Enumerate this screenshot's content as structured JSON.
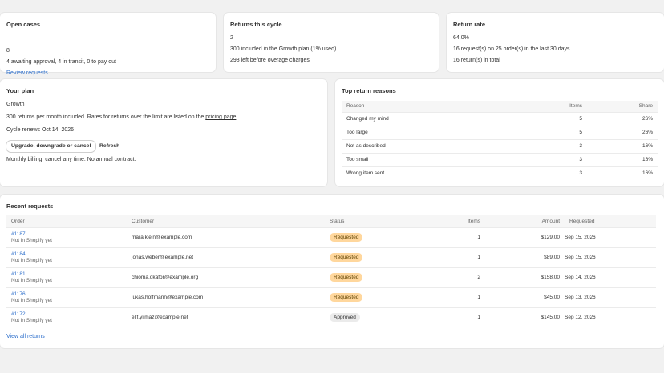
{
  "open_cases": {
    "title": "Open cases",
    "value": "8",
    "detail": "4 awaiting approval, 4 in transit, 0 to pay out",
    "link": "Review requests"
  },
  "returns_cycle": {
    "title": "Returns this cycle",
    "value": "2",
    "included": "300 included in the Growth plan (1% used)",
    "left": "298 left before overage charges"
  },
  "return_rate": {
    "title": "Return rate",
    "value": "64.0%",
    "detail": "16 request(s) on 25 order(s) in the last 30 days",
    "total": "16 return(s) in total"
  },
  "plan": {
    "title": "Your plan",
    "name": "Growth",
    "desc_prefix": "300 returns per month included. Rates for returns over the limit are listed on the ",
    "desc_link": "pricing page",
    "desc_suffix": ".",
    "renews": "Cycle renews Oct 14, 2026",
    "upgrade_label": "Upgrade, downgrade or cancel",
    "refresh_label": "Refresh",
    "billing_note": "Monthly billing, cancel any time. No annual contract."
  },
  "reasons": {
    "title": "Top return reasons",
    "headers": {
      "reason": "Reason",
      "items": "Items",
      "share": "Share"
    },
    "rows": [
      {
        "reason": "Changed my mind",
        "items": "5",
        "share": "26%"
      },
      {
        "reason": "Too large",
        "items": "5",
        "share": "26%"
      },
      {
        "reason": "Not as described",
        "items": "3",
        "share": "16%"
      },
      {
        "reason": "Too small",
        "items": "3",
        "share": "16%"
      },
      {
        "reason": "Wrong item sent",
        "items": "3",
        "share": "16%"
      }
    ]
  },
  "recent": {
    "title": "Recent requests",
    "headers": {
      "order": "Order",
      "customer": "Customer",
      "status": "Status",
      "items": "Items",
      "amount": "Amount",
      "requested": "Requested"
    },
    "rows": [
      {
        "order": "#1187",
        "sub": "Not in Shopify yet",
        "customer": "mara.klein@example.com",
        "status": "Requested",
        "items": "1",
        "amount": "$129.00",
        "requested": "Sep 15, 2026"
      },
      {
        "order": "#1184",
        "sub": "Not in Shopify yet",
        "customer": "jonas.weber@example.net",
        "status": "Requested",
        "items": "1",
        "amount": "$89.00",
        "requested": "Sep 15, 2026"
      },
      {
        "order": "#1181",
        "sub": "Not in Shopify yet",
        "customer": "chioma.okafor@example.org",
        "status": "Requested",
        "items": "2",
        "amount": "$158.00",
        "requested": "Sep 14, 2026"
      },
      {
        "order": "#1176",
        "sub": "Not in Shopify yet",
        "customer": "lukas.hoffmann@example.com",
        "status": "Requested",
        "items": "1",
        "amount": "$45.00",
        "requested": "Sep 13, 2026"
      },
      {
        "order": "#1172",
        "sub": "Not in Shopify yet",
        "customer": "elif.yilmaz@example.net",
        "status": "Approved",
        "items": "1",
        "amount": "$145.00",
        "requested": "Sep 12, 2026"
      }
    ],
    "view_all": "View all returns"
  }
}
